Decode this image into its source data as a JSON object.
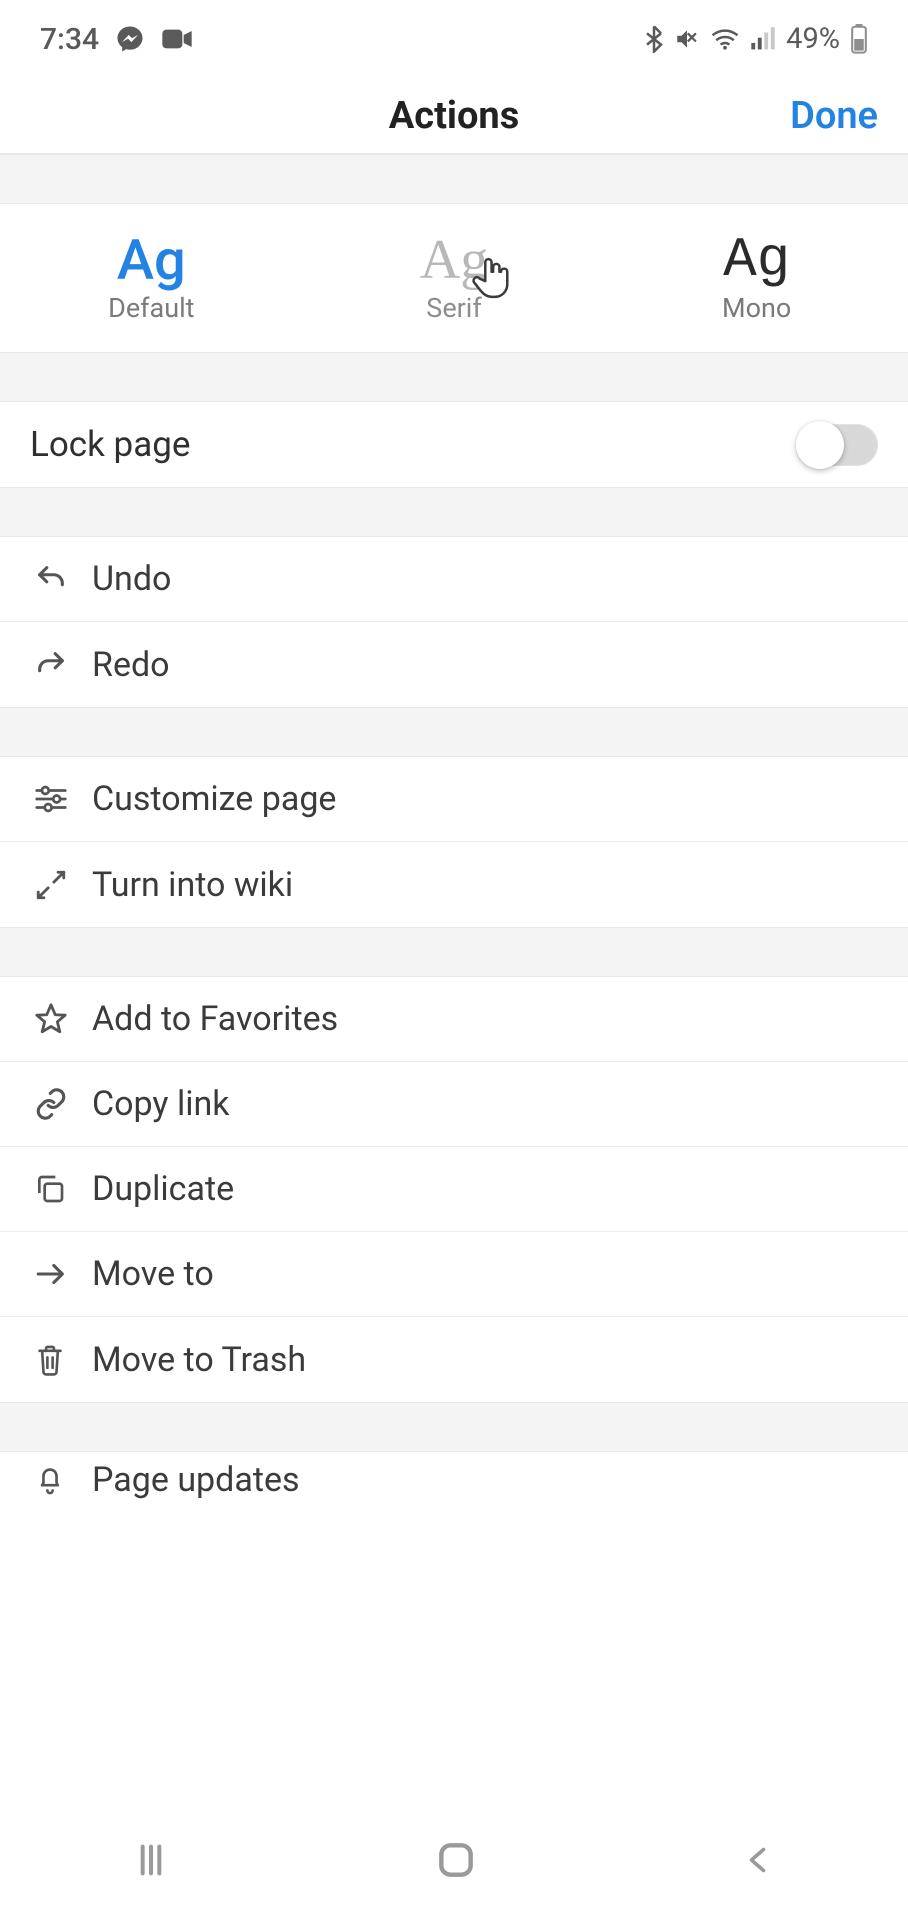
{
  "statusbar": {
    "time": "7:34",
    "battery": "49%"
  },
  "header": {
    "title": "Actions",
    "done": "Done"
  },
  "fonts": {
    "default": {
      "sample": "Ag",
      "label": "Default"
    },
    "serif": {
      "sample": "Ag",
      "label": "Serif"
    },
    "mono": {
      "sample": "Ag",
      "label": "Mono"
    }
  },
  "lock": {
    "label": "Lock page",
    "on": false
  },
  "rows": {
    "undo": "Undo",
    "redo": "Redo",
    "customize": "Customize page",
    "wiki": "Turn into wiki",
    "favorites": "Add to Favorites",
    "copylink": "Copy link",
    "duplicate": "Duplicate",
    "moveto": "Move to",
    "trash": "Move to Trash",
    "pageupdates": "Page updates"
  }
}
